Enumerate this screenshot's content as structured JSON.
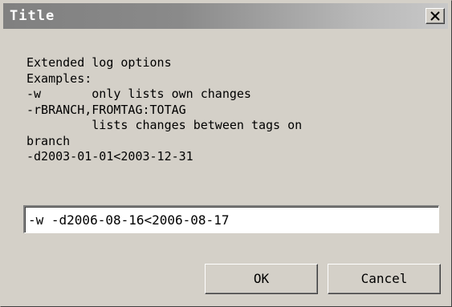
{
  "window": {
    "title": "Title",
    "close_glyph": "close-icon"
  },
  "message": {
    "lines": [
      "Extended log options",
      "Examples:",
      "-w       only lists own changes",
      "-rBRANCH,FROMTAG:TOTAG",
      "         lists changes between tags on",
      "branch",
      "-d2003-01-01<2003-12-31"
    ]
  },
  "input": {
    "value": "-w -d2006-08-16<2006-08-17"
  },
  "buttons": {
    "ok_label": "OK",
    "cancel_label": "Cancel"
  },
  "colors": {
    "dialog_bg": "#d4d0c8",
    "titlebar_start": "#808080",
    "titlebar_end": "#c8c8c8",
    "title_text": "#ffffff"
  }
}
